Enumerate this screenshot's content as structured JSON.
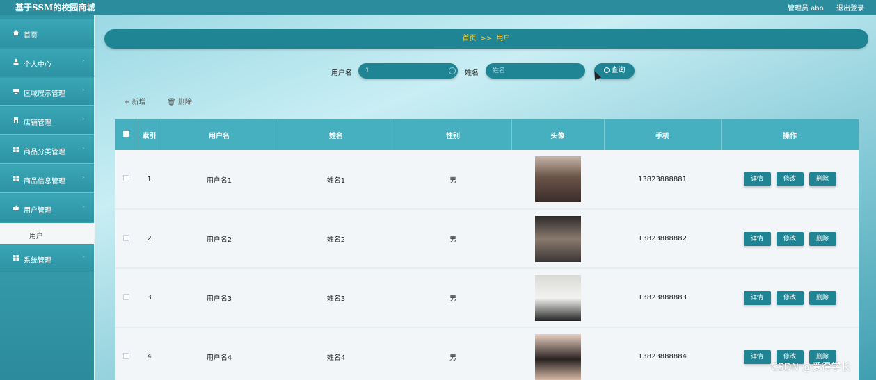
{
  "header": {
    "title": "基于SSM的校园商城",
    "admin_label": "管理员 abo",
    "logout_label": "退出登录"
  },
  "sidebar": {
    "items": [
      {
        "label": "首页",
        "icon": "home-icon"
      },
      {
        "label": "个人中心",
        "icon": "user-icon"
      },
      {
        "label": "区域展示管理",
        "icon": "display-icon"
      },
      {
        "label": "店铺管理",
        "icon": "store-icon"
      },
      {
        "label": "商品分类管理",
        "icon": "grid-icon"
      },
      {
        "label": "商品信息管理",
        "icon": "grid-icon"
      },
      {
        "label": "用户管理",
        "icon": "thumb-icon"
      },
      {
        "label": "系统管理",
        "icon": "grid-icon"
      }
    ],
    "active_sub": "用户"
  },
  "breadcrumb": {
    "home": "首页",
    "sep": ">>",
    "current": "用户"
  },
  "search": {
    "username_label": "用户名",
    "username_value": "1",
    "name_label": "姓名",
    "name_placeholder": "姓名",
    "query_label": "查询"
  },
  "actions": {
    "add_label": "+ 新增",
    "delete_label": "删除"
  },
  "table": {
    "headers": [
      "",
      "索引",
      "用户名",
      "姓名",
      "性别",
      "头像",
      "手机",
      "操作"
    ],
    "rows": [
      {
        "index": "1",
        "username": "用户名1",
        "name": "姓名1",
        "gender": "男",
        "phone": "13823888881"
      },
      {
        "index": "2",
        "username": "用户名2",
        "name": "姓名2",
        "gender": "男",
        "phone": "13823888882"
      },
      {
        "index": "3",
        "username": "用户名3",
        "name": "姓名3",
        "gender": "男",
        "phone": "13823888883"
      },
      {
        "index": "4",
        "username": "用户名4",
        "name": "姓名4",
        "gender": "男",
        "phone": "13823888884"
      }
    ],
    "op_detail": "详情",
    "op_edit": "修改",
    "op_delete": "删除"
  },
  "watermark": "CSDN @爱得学长",
  "colors": {
    "accent": "#1f8595",
    "header_bg": "#2b8c9e",
    "breadcrumb_text": "#f7d44a"
  }
}
